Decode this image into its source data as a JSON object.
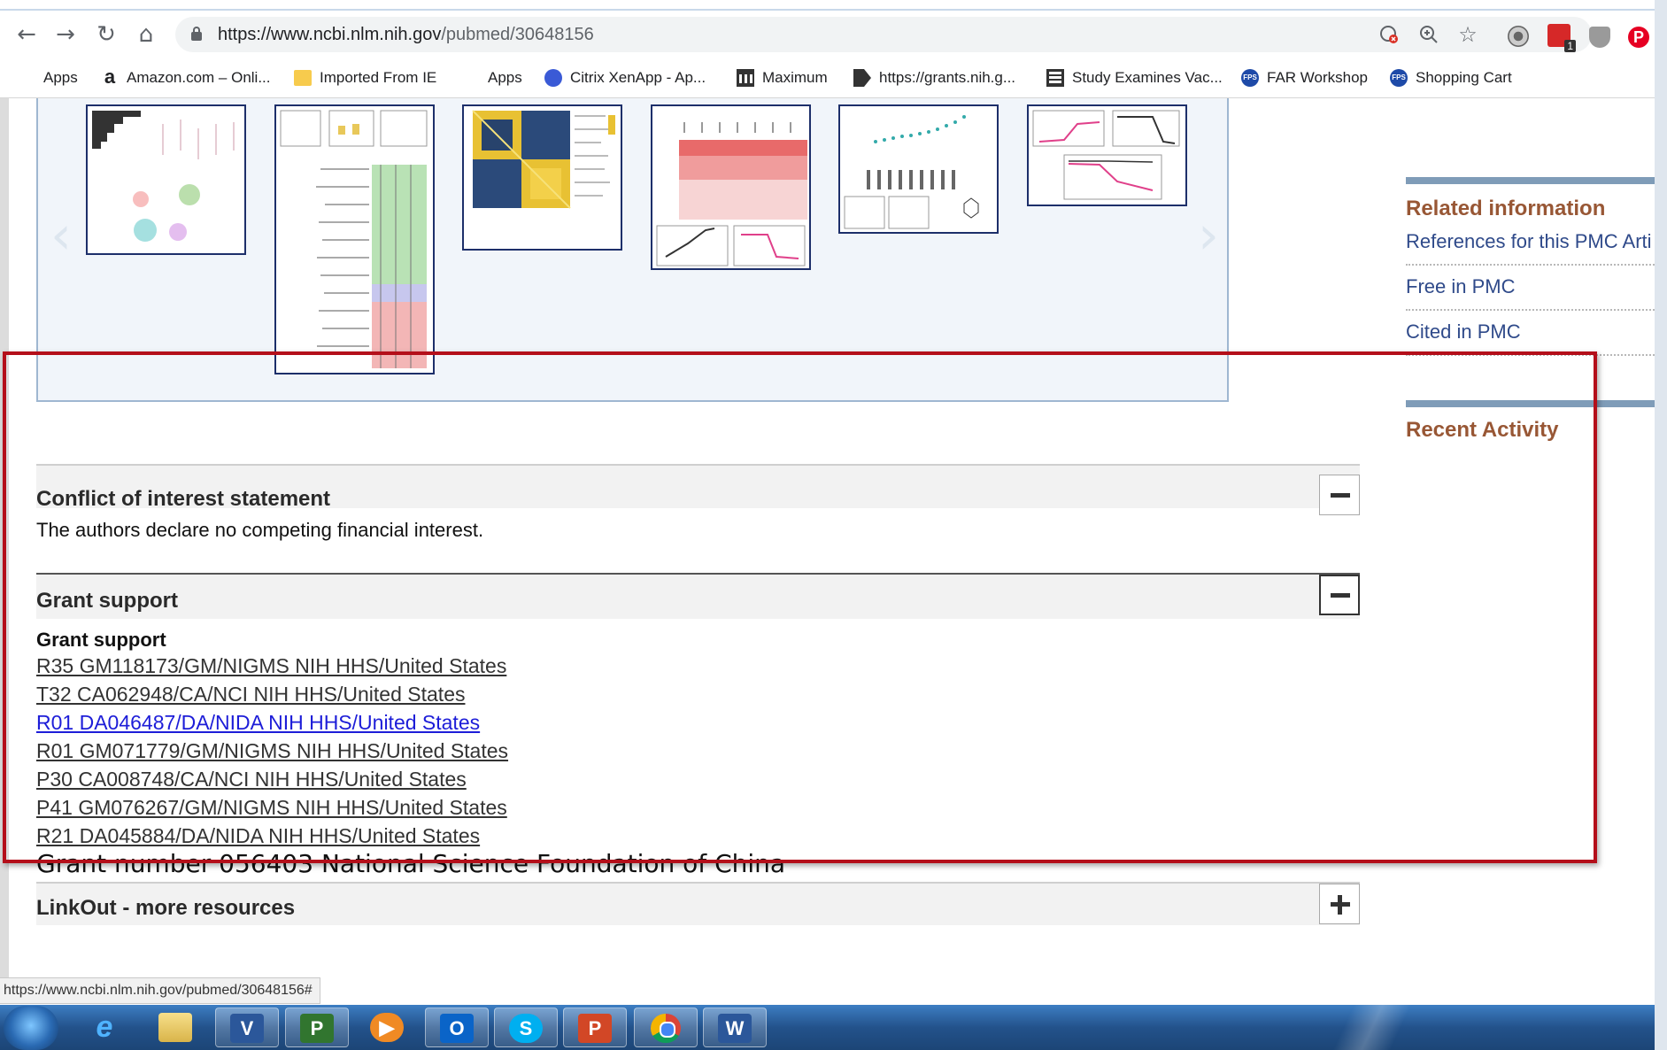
{
  "browser": {
    "url_domain": "https://www.ncbi.nlm.nih.gov",
    "url_path": "/pubmed/30648156",
    "back_icon": "←",
    "forward_icon": "→",
    "reload_icon": "↻",
    "home_icon": "⌂",
    "zoom_icon": "⚲",
    "star_icon": "☆",
    "ext_badge": "1"
  },
  "bookmarks": [
    {
      "label": "Apps",
      "icon": "apps-grid-icon"
    },
    {
      "label": "Amazon.com – Onli...",
      "icon": "amazon-icon",
      "glyph": "a"
    },
    {
      "label": "Imported From IE",
      "icon": "folder-icon"
    },
    {
      "label": "Apps",
      "icon": "apps-grid-icon"
    },
    {
      "label": "Citrix XenApp - Ap...",
      "icon": "citrix-icon"
    },
    {
      "label": "Maximum",
      "icon": "bank-icon"
    },
    {
      "label": "https://grants.nih.g...",
      "icon": "grants-icon"
    },
    {
      "label": "Study Examines Vac...",
      "icon": "news-icon"
    },
    {
      "label": "FAR Workshop",
      "icon": "fps-icon",
      "glyph": "FPS"
    },
    {
      "label": "Shopping Cart",
      "icon": "fps-icon",
      "glyph": "FPS"
    }
  ],
  "sidebar": {
    "related_heading": "Related information",
    "related_links": [
      "References for this PMC Arti",
      "Free in PMC",
      "Cited in PMC"
    ],
    "recent_heading": "Recent Activity"
  },
  "conflict": {
    "title": "Conflict of interest statement",
    "text": "The authors declare no competing financial interest."
  },
  "grant": {
    "title": "Grant support",
    "subheading": "Grant support",
    "links": [
      "R35 GM118173/GM/NIGMS NIH HHS/United States",
      "T32 CA062948/CA/NCI NIH HHS/United States",
      "R01 DA046487/DA/NIDA NIH HHS/United States",
      "R01 GM071779/GM/NIGMS NIH HHS/United States",
      "P30 CA008748/CA/NCI NIH HHS/United States",
      "P41 GM076267/GM/NIGMS NIH HHS/United States",
      "R21 DA045884/DA/NIDA NIH HHS/United States"
    ],
    "active_link_index": 2,
    "extra_note": "Grant number 056403 National Science Foundation of China"
  },
  "linkout": {
    "title": "LinkOut - more resources"
  },
  "status_url": "https://www.ncbi.nlm.nih.gov/pubmed/30648156#",
  "taskbar": {
    "apps": [
      "internet-explorer",
      "file-explorer",
      "visio",
      "project",
      "media-player",
      "outlook",
      "skype",
      "powerpoint",
      "chrome",
      "word"
    ],
    "labels": [
      "e",
      "",
      "V",
      "P",
      "▶",
      "O",
      "S",
      "P",
      "",
      "W"
    ]
  },
  "colors": {
    "accent_red": "#b40f1a",
    "sidebar_heading": "#985735",
    "link_active": "#1d1dd8",
    "panel_border": "#9fb7d1"
  }
}
